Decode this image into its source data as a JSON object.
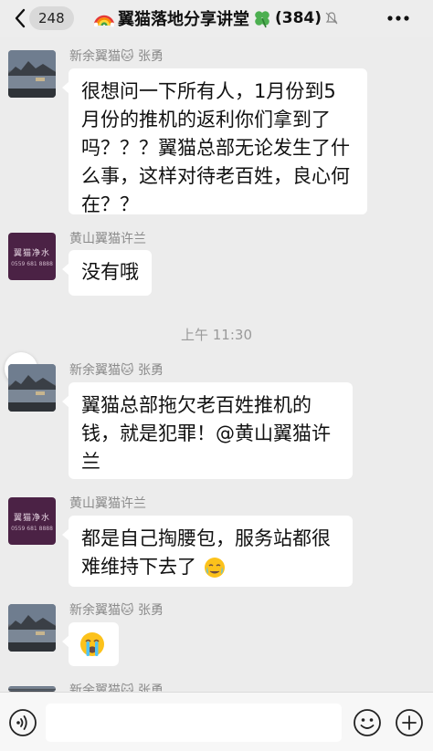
{
  "header": {
    "back_count": "248",
    "title": "翼猫落地分享讲堂",
    "member_count": "(384)"
  },
  "messages": [
    {
      "sender": "新余翼猫🐱 张勇",
      "text": "很想问一下所有人，1月份到5月份的推机的返利你们拿到了吗？？？翼猫总部无论发生了什么事，这样对待老百姓，良心何在？？"
    },
    {
      "sender": "黄山翼猫许兰",
      "text": "没有哦"
    },
    {
      "sender": "新余翼猫🐱 张勇",
      "text": "翼猫总部拖欠老百姓推机的钱，就是犯罪！@黄山翼猫许兰"
    },
    {
      "sender": "黄山翼猫许兰",
      "text": "都是自己掏腰包，服务站都很难维持下去了"
    },
    {
      "sender": "新余翼猫🐱 张勇",
      "text": ""
    },
    {
      "sender": "新余翼猫🐱 张勇",
      "text": ""
    }
  ],
  "timestamp": "上午 11:30",
  "avatar_store": {
    "name": "翼猫净水",
    "phone": "0559 681 8888"
  },
  "icons": {
    "back": "chevron-left-icon",
    "rainbow": "rainbow-icon",
    "clover": "four-leaf-clover-icon",
    "mute": "bell-muted-icon",
    "more": "more-dots-icon",
    "voice": "voice-icon",
    "sticker": "emoji-icon",
    "add": "plus-circle-icon",
    "crying_face": "crying-face-icon",
    "teary_face": "teary-face-icon"
  },
  "colors": {
    "background": "#ececec",
    "bubble": "#ffffff",
    "sender_text": "#8a8a8a",
    "store_avatar": "#4b2245"
  }
}
